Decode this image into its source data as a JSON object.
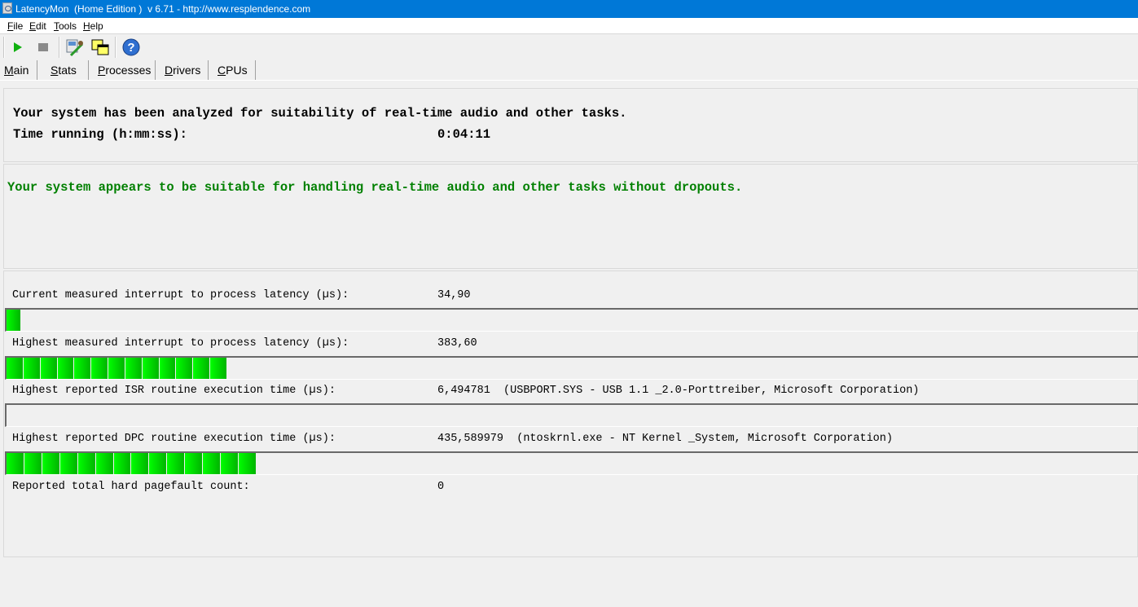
{
  "window": {
    "title": "LatencyMon  (Home Edition )  v 6.71 - http://www.resplendence.com"
  },
  "menu": [
    "File",
    "Edit",
    "Tools",
    "Help"
  ],
  "toolbar": {
    "buttons": [
      "play-icon",
      "stop-icon",
      "tools-icon",
      "windows-icon",
      "help-icon"
    ]
  },
  "tabs": [
    "Main",
    "Stats",
    "Processes",
    "Drivers",
    "CPUs"
  ],
  "summary": {
    "analyzed_text": "Your system has been analyzed for suitability of real-time audio and other tasks.",
    "time_label": "Time running (h:mm:ss):",
    "time_value": "0:04:11"
  },
  "verdict": {
    "text": "Your system appears to be suitable for handling real-time audio and other tasks without dropouts.",
    "color": "#008000"
  },
  "metrics": [
    {
      "label": "Current measured interrupt to process latency (µs):",
      "value": "34,90",
      "bar_fraction": 0.013,
      "segments": 1
    },
    {
      "label": "Highest measured interrupt to process latency (µs):",
      "value": "383,60",
      "bar_fraction": 0.195,
      "segments": 13
    },
    {
      "label": "Highest reported ISR routine execution time (µs):",
      "value": "6,494781  (USBPORT.SYS - USB 1.1 _2.0-Porttreiber, Microsoft Corporation)",
      "bar_fraction": 0,
      "segments": 0
    },
    {
      "label": "Highest reported DPC routine execution time (µs):",
      "value": "435,589979  (ntoskrnl.exe - NT Kernel _System, Microsoft Corporation)",
      "bar_fraction": 0.221,
      "segments": 14
    }
  ],
  "pagefault": {
    "label": "Reported total hard pagefault count:",
    "value": "0"
  }
}
